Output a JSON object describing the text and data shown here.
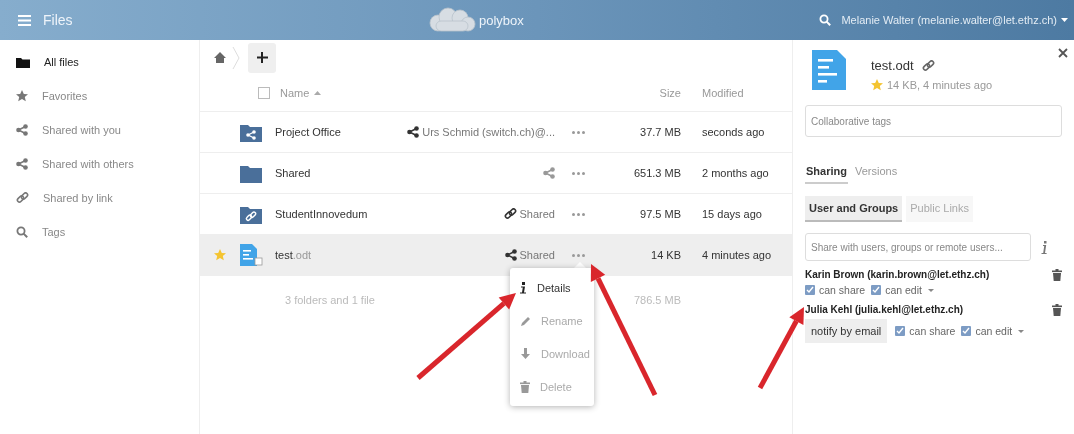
{
  "header": {
    "title": "Files",
    "logo_text": "polybox",
    "user": "Melanie Walter (melanie.walter@let.ethz.ch)"
  },
  "sidebar": {
    "items": [
      {
        "label": "All files",
        "kind": "folder",
        "selected": true
      },
      {
        "label": "Favorites",
        "kind": "star",
        "selected": false
      },
      {
        "label": "Shared with you",
        "kind": "share",
        "selected": false
      },
      {
        "label": "Shared with others",
        "kind": "share",
        "selected": false
      },
      {
        "label": "Shared by link",
        "kind": "link",
        "selected": false
      },
      {
        "label": "Tags",
        "kind": "search",
        "selected": false
      }
    ]
  },
  "files": {
    "select_all": {
      "checked": false
    },
    "columns": {
      "name": "Name",
      "size": "Size",
      "modified": "Modified"
    },
    "rows": [
      {
        "name": "Project Office",
        "extension": "",
        "kind": "shared-folder",
        "favorite": false,
        "share": "Urs Schmid (switch.ch)@...",
        "size": "37.7 MB",
        "modified": "seconds ago",
        "selected": false
      },
      {
        "name": "Shared",
        "extension": "",
        "kind": "folder",
        "favorite": false,
        "share": "",
        "size": "651.3 MB",
        "modified": "2 months ago",
        "selected": false
      },
      {
        "name": "StudentInnovedum",
        "extension": "",
        "kind": "link-folder",
        "favorite": false,
        "share": "Shared",
        "size": "97.5 MB",
        "modified": "15 days ago",
        "selected": false
      },
      {
        "name": "test",
        "extension": ".odt",
        "kind": "document",
        "favorite": true,
        "share": "Shared",
        "size": "14 KB",
        "modified": "4 minutes ago",
        "selected": true
      }
    ],
    "summary": {
      "count": "3 folders and 1 file",
      "size": "786.5 MB"
    },
    "menu": [
      {
        "label": "Details",
        "kind": "info",
        "selected": true
      },
      {
        "label": "Rename",
        "kind": "pencil",
        "selected": false
      },
      {
        "label": "Download",
        "kind": "download",
        "selected": false
      },
      {
        "label": "Delete",
        "kind": "trash",
        "selected": false
      }
    ]
  },
  "details": {
    "file_name": "test.odt",
    "favorite": true,
    "meta": "14 KB, 4 minutes ago",
    "tags": {
      "placeholder": "Collaborative tags"
    },
    "tabs": [
      {
        "label": "Sharing",
        "selected": true
      },
      {
        "label": "Versions",
        "selected": false
      }
    ],
    "subtabs": [
      {
        "label": "User and Groups",
        "selected": true
      },
      {
        "label": "Public Links",
        "selected": false
      }
    ],
    "share_field": {
      "placeholder": "Share with users, groups or remote users..."
    },
    "shares": [
      {
        "name": "Karin Brown (karin.brown@let.ethz.ch)",
        "permissions": [
          {
            "label": "can share",
            "checked": true
          },
          {
            "label": "can edit",
            "checked": true
          }
        ]
      },
      {
        "name": "Julia Kehl (julia.kehl@let.ethz.ch)",
        "notify": "notify by email",
        "permissions": [
          {
            "label": "can share",
            "checked": true
          },
          {
            "label": "can edit",
            "checked": true
          }
        ]
      }
    ]
  }
}
